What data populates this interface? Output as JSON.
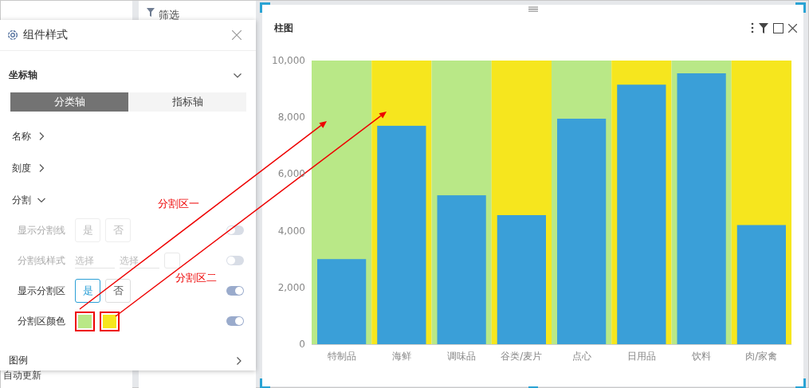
{
  "background": {
    "filter_title": "筛选",
    "auto_update": "自动更新"
  },
  "style_panel": {
    "title": "组件样式",
    "section": "坐标轴",
    "axis_tabs": [
      {
        "label": "分类轴",
        "selected": true
      },
      {
        "label": "指标轴",
        "selected": false
      }
    ],
    "groups": [
      {
        "label": "名称",
        "expanded": false
      },
      {
        "label": "刻度",
        "expanded": false
      },
      {
        "label": "分割",
        "expanded": true
      }
    ],
    "rows": [
      {
        "kind": "choice",
        "label": "显示分割线",
        "disabled": true,
        "on": false,
        "options": [
          {
            "label": "是",
            "selected": false
          },
          {
            "label": "否",
            "selected": false
          }
        ]
      },
      {
        "kind": "style",
        "label": "分割线样式",
        "disabled": true,
        "on": false,
        "selects": [
          {
            "placeholder": "选择"
          },
          {
            "placeholder": "选择"
          }
        ]
      },
      {
        "kind": "choice",
        "label": "显示分割区",
        "disabled": false,
        "on": true,
        "options": [
          {
            "label": "是",
            "selected": true
          },
          {
            "label": "否",
            "selected": false
          }
        ]
      },
      {
        "kind": "colors",
        "label": "分割区颜色",
        "disabled": false,
        "on": true,
        "colors": [
          {
            "color": "#b9e887"
          },
          {
            "color": "#f6e61e"
          }
        ]
      }
    ],
    "legend": "图例"
  },
  "chart": {
    "title": "柱图",
    "chart_data": {
      "type": "bar",
      "categories": [
        "特制品",
        "海鲜",
        "调味品",
        "谷类/麦片",
        "点心",
        "日用品",
        "饮料",
        "肉/家禽"
      ],
      "series": [
        {
          "color": "#3a9fd8",
          "values": [
            3000,
            7700,
            5250,
            4550,
            7950,
            9150,
            9550,
            4200
          ]
        }
      ],
      "ylim": [
        0,
        10000
      ],
      "yticks": [
        {
          "value": 0,
          "label": "0"
        },
        {
          "value": 2000,
          "label": "2,000"
        },
        {
          "value": 4000,
          "label": "4,000"
        },
        {
          "value": 6000,
          "label": "6,000"
        },
        {
          "value": 8000,
          "label": "8,000"
        },
        {
          "value": 10000,
          "label": "10,000"
        }
      ]
    }
  },
  "annotations": [
    {
      "text": "分割区一"
    },
    {
      "text": "分割区二"
    }
  ]
}
